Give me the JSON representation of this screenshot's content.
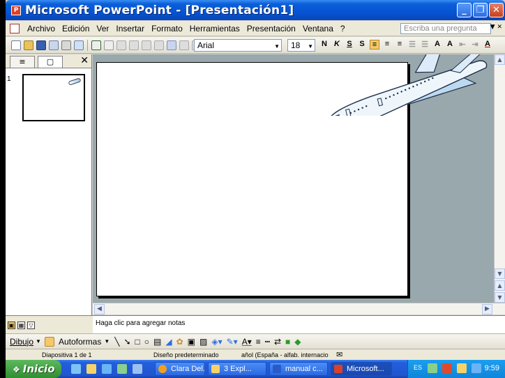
{
  "window": {
    "title": "Microsoft PowerPoint - [Presentación1]",
    "minimize": "_",
    "maximize": "❐",
    "close": "✕"
  },
  "menu": {
    "items": [
      "Archivo",
      "Edición",
      "Ver",
      "Insertar",
      "Formato",
      "Herramientas",
      "Presentación",
      "Ventana",
      "?"
    ],
    "ask_placeholder": "Escriba una pregunta"
  },
  "toolbar": {
    "font": "Arial",
    "size": "18",
    "bold": "N",
    "italic": "K",
    "underline": "S",
    "shadow": "S"
  },
  "leftpane": {
    "tab_outline": "≡",
    "tab_slides": "▢",
    "close": "✕",
    "slide_number": "1"
  },
  "notes": {
    "placeholder": "Haga clic para agregar notas"
  },
  "drawbar": {
    "draw_label": "Dibujo",
    "autoshapes_label": "Autoformas"
  },
  "status": {
    "slide": "Diapositiva 1 de 1",
    "design": "Diseño predeterminado",
    "language": "añol (España - alfab. internacio"
  },
  "taskbar": {
    "start": "Inicio",
    "tasks": [
      "Clara Del...",
      "3 Expl...",
      "manual c...",
      "Microsoft..."
    ],
    "clock": "9:59",
    "lang": "ES"
  },
  "colors": {
    "titlebar": "#0654d4",
    "slide_bg": "#ffffff",
    "workspace": "#99a8ac",
    "taskbar": "#245edb",
    "start": "#3c9a3c"
  }
}
